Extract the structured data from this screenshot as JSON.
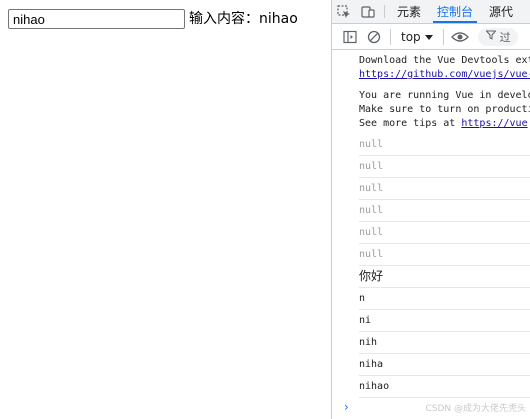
{
  "page": {
    "input_value": "nihao",
    "output_text": "输入内容：nihao"
  },
  "devtools": {
    "tabs": [
      {
        "label": "元素"
      },
      {
        "label": "控制台",
        "active": true
      },
      {
        "label": "源代"
      }
    ],
    "toolbar": {
      "context": "top",
      "filter_label": "过"
    },
    "console": {
      "messages": [
        {
          "line1": "Download the Vue Devtools ext",
          "link": "https://github.com/vuejs/vue-"
        },
        {
          "line1": "You are running Vue in develo",
          "line2": "Make sure to turn on producti",
          "line3_prefix": "See more tips at ",
          "link": "https://vue"
        }
      ],
      "rows": [
        "null",
        "null",
        "null",
        "null",
        "null",
        "null",
        "你好",
        "n",
        "ni",
        "nih",
        "niha",
        "nihao"
      ]
    },
    "watermark": "CSDN @成为大佬先秃头"
  },
  "colors": {
    "accent": "#1a73e8",
    "link": "#1a0dab",
    "null_text": "#9aa0a6"
  }
}
